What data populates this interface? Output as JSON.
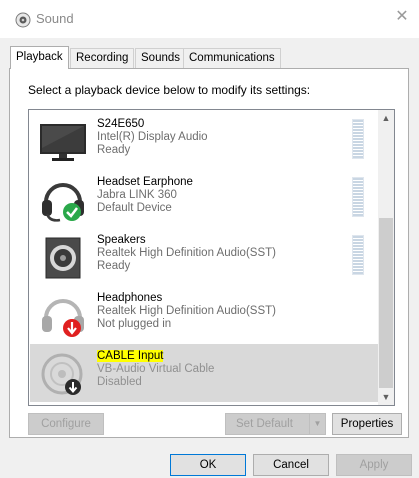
{
  "window": {
    "title": "Sound",
    "icon": "speaker-icon",
    "close_glyph": "✕"
  },
  "tabs": [
    {
      "label": "Playback",
      "active": true
    },
    {
      "label": "Recording",
      "active": false
    },
    {
      "label": "Sounds",
      "active": false
    },
    {
      "label": "Communications",
      "active": false
    }
  ],
  "instruction": "Select a playback device below to modify its settings:",
  "devices": [
    {
      "name": "S24E650",
      "driver": "Intel(R) Display Audio",
      "status": "Ready",
      "icon": "monitor-icon",
      "selected": false
    },
    {
      "name": "Headset Earphone",
      "driver": "Jabra LINK 360",
      "status": "Default Device",
      "icon": "headset-icon",
      "badge": "default-check-badge",
      "selected": false
    },
    {
      "name": "Speakers",
      "driver": "Realtek High Definition Audio(SST)",
      "status": "Ready",
      "icon": "speaker-box-icon",
      "selected": false
    },
    {
      "name": "Headphones",
      "driver": "Realtek High Definition Audio(SST)",
      "status": "Not plugged in",
      "icon": "headphones-icon",
      "badge": "unplugged-badge",
      "selected": false
    },
    {
      "name": "CABLE Input",
      "driver": "VB-Audio Virtual Cable",
      "status": "Disabled",
      "icon": "cable-icon",
      "badge": "disabled-badge",
      "selected": true,
      "highlighted": true
    }
  ],
  "buttons": {
    "configure": "Configure",
    "set_default": "Set Default",
    "properties": "Properties",
    "ok": "OK",
    "cancel": "Cancel",
    "apply": "Apply"
  },
  "colors": {
    "selection": "#d9d9d9",
    "highlight": "#ffff00",
    "check_badge": "#2aa84a",
    "down_badge": "#e02020",
    "meter": "#c9d6e3",
    "focus_border": "#0078d7"
  }
}
